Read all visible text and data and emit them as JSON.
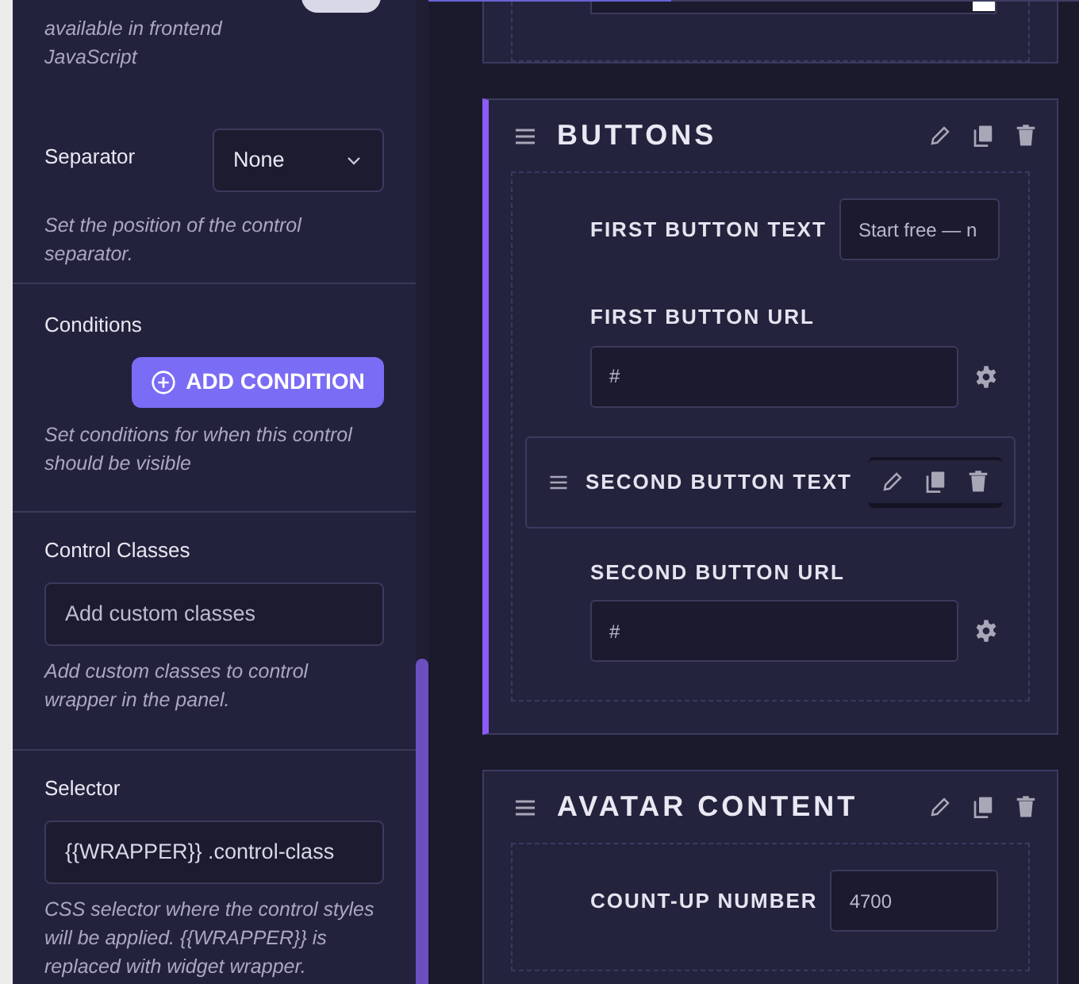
{
  "settings_panel": {
    "sections": [
      {
        "kind": "toggle_note",
        "help": "available in frontend JavaScript",
        "on": true
      },
      {
        "kind": "select",
        "label": "Separator",
        "value": "None",
        "help": "Set the position of the control separator."
      },
      {
        "kind": "button",
        "label": "Conditions",
        "button": "ADD CONDITION",
        "help": "Set conditions for when this control should be visible"
      },
      {
        "kind": "input",
        "label": "Control Classes",
        "placeholder": "Add custom classes",
        "help": "Add custom classes to control wrapper in the panel."
      },
      {
        "kind": "input",
        "label": "Selector",
        "value": "{{WRAPPER}} .control-class",
        "help": "CSS selector where the control styles will be applied. {{WRAPPER}} is replaced with widget wrapper."
      }
    ]
  },
  "groups": [
    {
      "kind": "partial",
      "selected": false
    },
    {
      "kind": "group",
      "title": "BUTTONS",
      "selected": true,
      "fields": [
        {
          "kind": "inline",
          "label": "FIRST BUTTON TEXT",
          "value": "Start free — n"
        },
        {
          "kind": "stacked",
          "label": "FIRST BUTTON URL",
          "value": "#"
        },
        {
          "kind": "actions",
          "label": "SECOND BUTTON TEXT",
          "hovered": true
        },
        {
          "kind": "stacked",
          "label": "SECOND BUTTON URL",
          "value": "#"
        }
      ]
    },
    {
      "kind": "group",
      "title": "AVATAR CONTENT",
      "selected": false,
      "fields": [
        {
          "kind": "inline",
          "label": "COUNT-UP NUMBER",
          "value": "4700"
        }
      ]
    }
  ]
}
